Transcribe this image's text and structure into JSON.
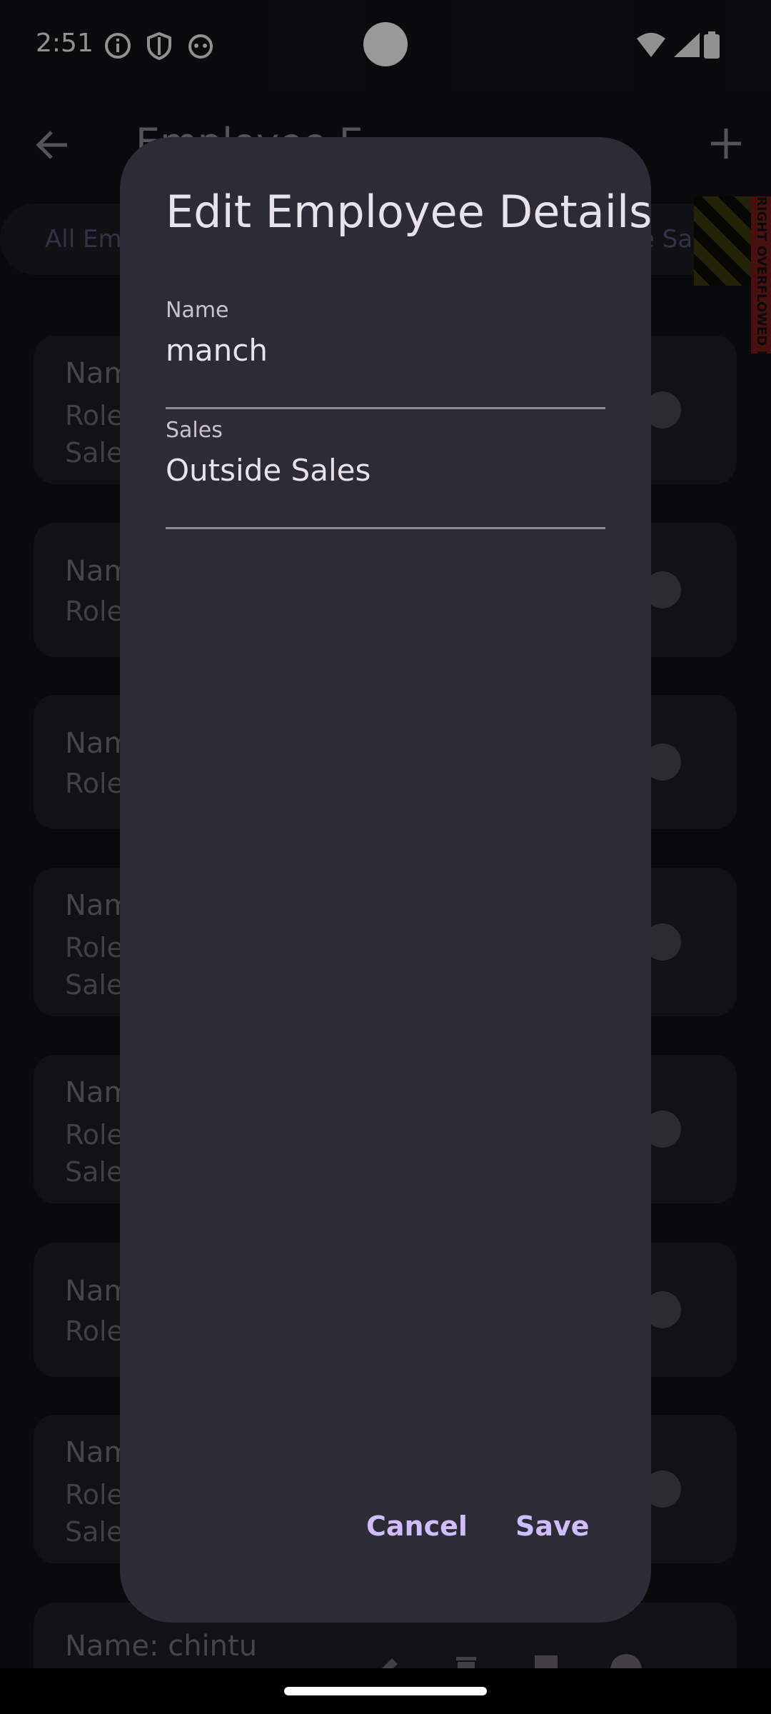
{
  "status_bar": {
    "time": "2:51"
  },
  "app_bar": {
    "title": "Employee E"
  },
  "filter_chips": [
    {
      "label": "All Em"
    },
    {
      "label": "ide Sal"
    }
  ],
  "overflow_banner": {
    "text": "RIGHT OVERFLOWED BY"
  },
  "cards": [
    {
      "lines": [
        "Nam",
        "Role",
        "Sales"
      ]
    },
    {
      "lines": [
        "Nam",
        "Role"
      ]
    },
    {
      "lines": [
        "Nam",
        "Role"
      ]
    },
    {
      "lines": [
        "Nam",
        "Role",
        "Sales"
      ]
    },
    {
      "lines": [
        "Nam",
        "Role",
        "Sales"
      ]
    },
    {
      "lines": [
        "Nam",
        "Role"
      ]
    },
    {
      "lines": [
        "Nam",
        "Role",
        "Sales"
      ]
    },
    {
      "lines": [
        "Name: chintu"
      ]
    }
  ],
  "dialog": {
    "title": "Edit Employee Details",
    "name_field": {
      "label": "Name",
      "value": "manch"
    },
    "sales_field": {
      "label": "Sales",
      "value": "Outside Sales"
    },
    "cancel_label": "Cancel",
    "save_label": "Save"
  },
  "colors": {
    "accent": "#cfbdfe",
    "dialog_bg": "#2d2b35",
    "page_bg": "#121216"
  }
}
